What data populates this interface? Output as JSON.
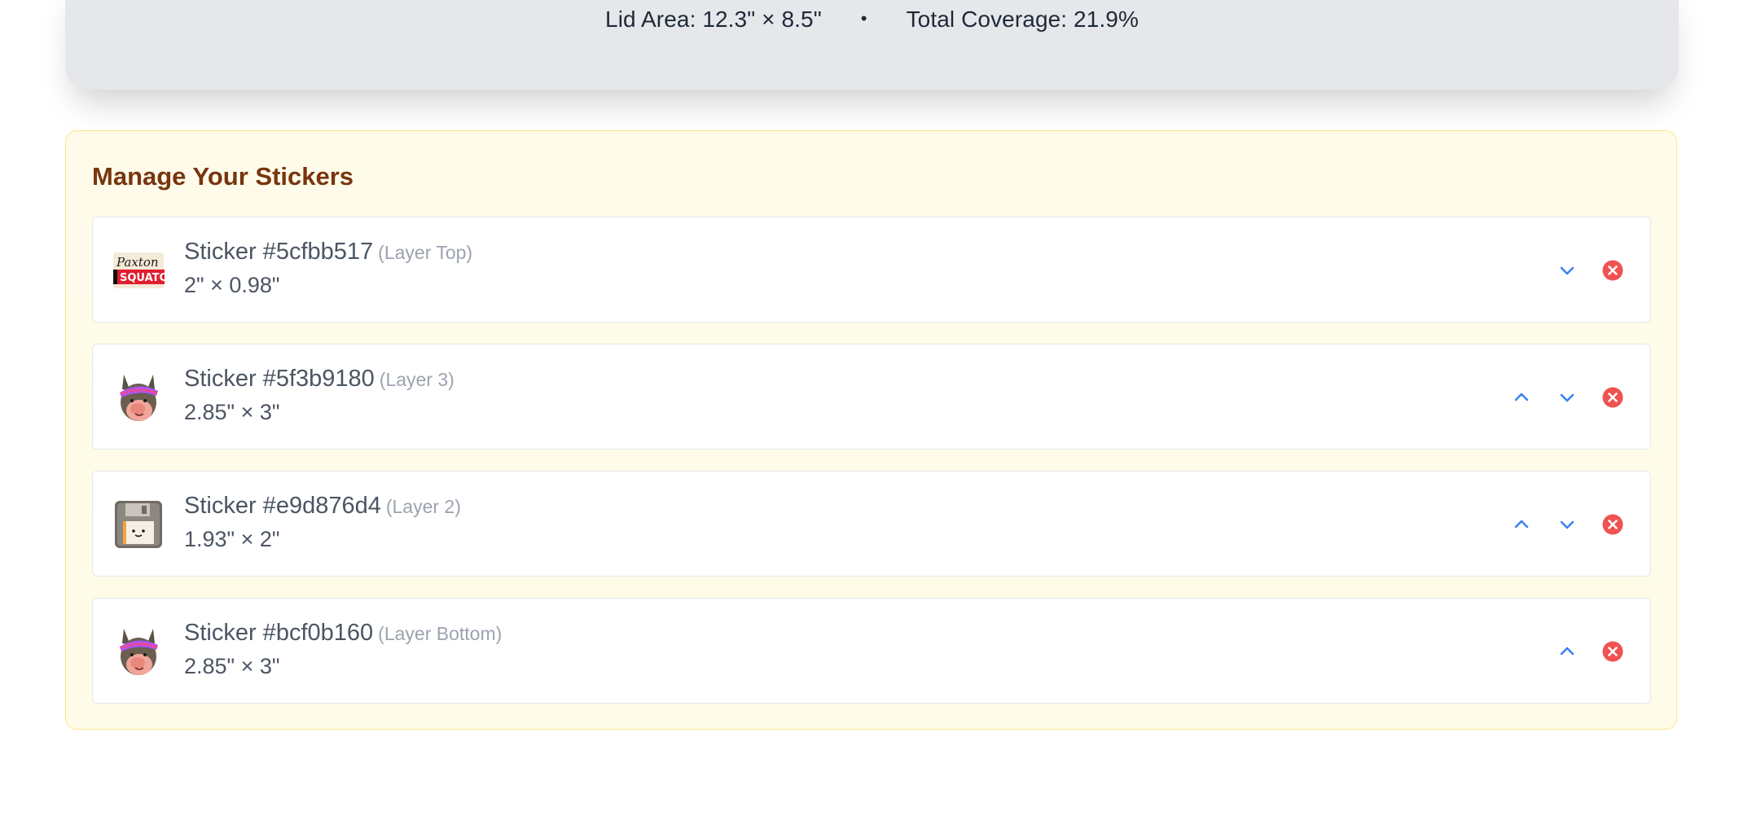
{
  "stats": {
    "lid_area": "Lid Area: 12.3\" × 8.5\"",
    "separator": "•",
    "total_coverage": "Total Coverage: 21.9%"
  },
  "manage": {
    "title": "Manage Your Stickers",
    "stickers": [
      {
        "name": "Sticker #5cfbb517",
        "layer": "(Layer Top)",
        "dims": "2\" × 0.98\"",
        "thumb_icon": "paxton-squatch-logo",
        "thumb_text_top": "Paxton",
        "thumb_text_bottom": "SQUATC",
        "controls": [
          "move-down",
          "remove"
        ]
      },
      {
        "name": "Sticker #5f3b9180",
        "layer": "(Layer 3)",
        "dims": "2.85\" × 3\"",
        "thumb_icon": "donkey-visor-face",
        "controls": [
          "move-up",
          "move-down",
          "remove"
        ]
      },
      {
        "name": "Sticker #e9d876d4",
        "layer": "(Layer 2)",
        "dims": "1.93\" × 2\"",
        "thumb_icon": "floppy-disk-face",
        "controls": [
          "move-up",
          "move-down",
          "remove"
        ]
      },
      {
        "name": "Sticker #bcf0b160",
        "layer": "(Layer Bottom)",
        "dims": "2.85\" × 3\"",
        "thumb_icon": "donkey-visor-face",
        "controls": [
          "move-up",
          "remove"
        ]
      }
    ]
  },
  "colors": {
    "accent_blue": "#3b82f6",
    "remove_red": "#f05252",
    "title_brown": "#78350f",
    "panel_border": "#fde68a"
  }
}
